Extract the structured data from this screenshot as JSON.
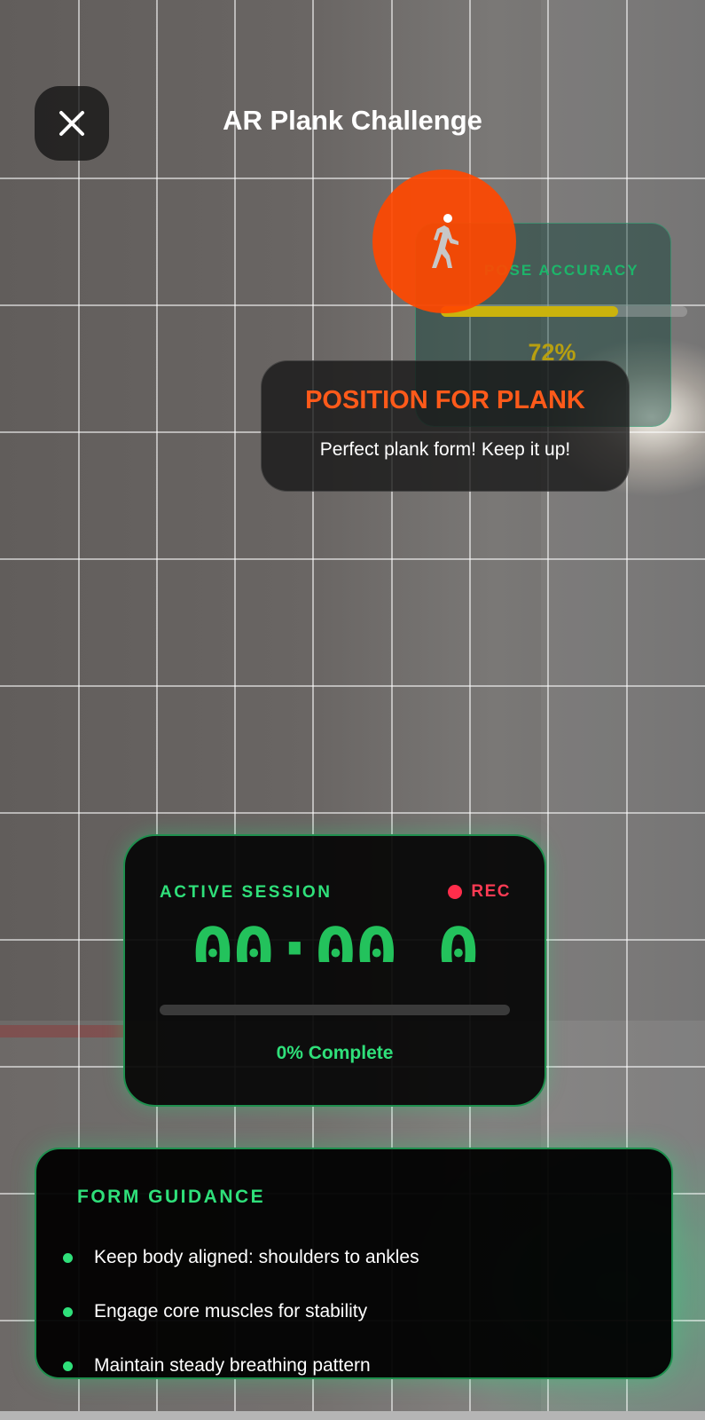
{
  "header": {
    "title": "AR Plank Challenge",
    "close_icon": "close-icon"
  },
  "pose_card": {
    "icon": "walking-person-icon",
    "label": "POSE ACCURACY",
    "value_text": "72%",
    "value": 0.72,
    "bar_color": "#cbb30c"
  },
  "status": {
    "title": "POSITION FOR PLANK",
    "message": "Perfect plank form! Keep it up!",
    "title_color": "#ff5a1a"
  },
  "session": {
    "label": "ACTIVE SESSION",
    "rec_label": "REC",
    "timer": "00:00.0",
    "progress": 0,
    "complete_text": "0% Complete",
    "accent_color": "#2fe07a",
    "rec_color": "#ff2d4b"
  },
  "guidance": {
    "title": "FORM GUIDANCE",
    "items": [
      "Keep body aligned: shoulders to ankles",
      "Engage core muscles for stability",
      "Maintain steady breathing pattern"
    ]
  }
}
